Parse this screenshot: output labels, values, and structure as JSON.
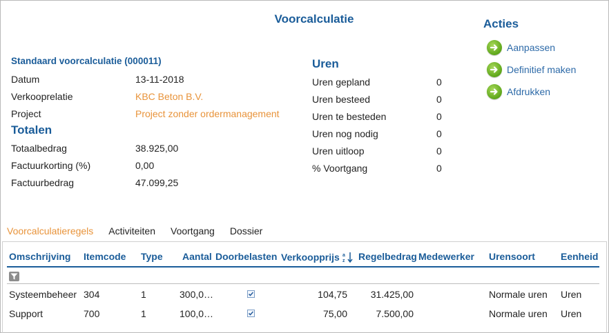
{
  "page": {
    "title": "Voorcalculatie"
  },
  "header": {
    "subtitle": "Standaard voorcalculatie (000011)",
    "fields": [
      {
        "label": "Datum",
        "value": "13-11-2018"
      },
      {
        "label": "Verkooprelatie",
        "value": "KBC Beton B.V."
      },
      {
        "label": "Project",
        "value": "Project zonder ordermanagement"
      }
    ]
  },
  "totals": {
    "title": "Totalen",
    "fields": [
      {
        "label": "Totaalbedrag",
        "value": "38.925,00"
      },
      {
        "label": "Factuurkorting (%)",
        "value": "0,00"
      },
      {
        "label": "Factuurbedrag",
        "value": "47.099,25"
      }
    ]
  },
  "hours": {
    "title": "Uren",
    "fields": [
      {
        "label": "Uren gepland",
        "value": "0"
      },
      {
        "label": "Uren besteed",
        "value": "0"
      },
      {
        "label": "Uren te besteden",
        "value": "0"
      },
      {
        "label": "Uren nog nodig",
        "value": "0"
      },
      {
        "label": "Uren uitloop",
        "value": "0"
      },
      {
        "label": "% Voortgang",
        "value": "0"
      }
    ]
  },
  "actions": {
    "title": "Acties",
    "items": [
      {
        "label": "Aanpassen",
        "icon": "arrow-right-icon"
      },
      {
        "label": "Definitief maken",
        "icon": "arrow-right-icon"
      },
      {
        "label": "Afdrukken",
        "icon": "arrow-right-icon"
      }
    ]
  },
  "tabs": [
    {
      "label": "Voorcalculatieregels",
      "active": true
    },
    {
      "label": "Activiteiten",
      "active": false
    },
    {
      "label": "Voortgang",
      "active": false
    },
    {
      "label": "Dossier",
      "active": false
    }
  ],
  "table": {
    "columns": [
      "Omschrijving",
      "Itemcode",
      "Type",
      "Aantal",
      "Doorbelasten",
      "Verkoopprijs",
      "Regelbedrag",
      "Medewerker",
      "Urensoort",
      "Eenheid"
    ],
    "sort_icon": "sort-az-icon",
    "rows": [
      {
        "omschrijving": "Systeembeheer",
        "itemcode": "304",
        "type": "1",
        "aantal": "300,0…",
        "doorbelasten": true,
        "verkoopprijs": "104,75",
        "regelbedrag": "31.425,00",
        "medewerker": "",
        "urensoort": "Normale uren",
        "eenheid": "Uren"
      },
      {
        "omschrijving": "Support",
        "itemcode": "700",
        "type": "1",
        "aantal": "100,0…",
        "doorbelasten": true,
        "verkoopprijs": "75,00",
        "regelbedrag": "7.500,00",
        "medewerker": "",
        "urensoort": "Normale uren",
        "eenheid": "Uren"
      }
    ]
  },
  "colors": {
    "heading": "#1a5c99",
    "link": "#e8933a",
    "action_green": "#5da619",
    "action_text": "#2d6aa8"
  }
}
